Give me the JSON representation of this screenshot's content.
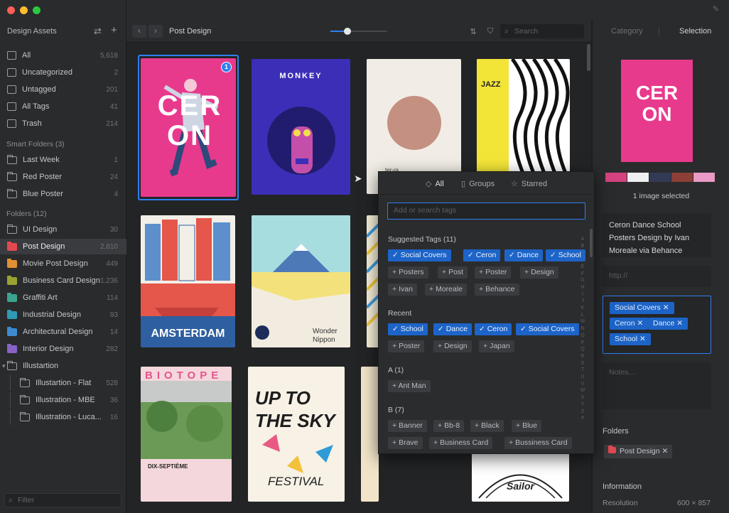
{
  "sidebar": {
    "title": "Design Assets",
    "library": [
      {
        "label": "All",
        "count": "5,618",
        "icon": "grid-icon"
      },
      {
        "label": "Uncategorized",
        "count": "2",
        "icon": "uncategorized-icon"
      },
      {
        "label": "Untagged",
        "count": "201",
        "icon": "untagged-icon"
      },
      {
        "label": "All Tags",
        "count": "41",
        "icon": "tag-icon"
      },
      {
        "label": "Trash",
        "count": "214",
        "icon": "trash-icon"
      }
    ],
    "smart_title": "Smart Folders (3)",
    "smart": [
      {
        "label": "Last Week",
        "count": "1"
      },
      {
        "label": "Red Poster",
        "count": "24"
      },
      {
        "label": "Blue Poster",
        "count": "4"
      }
    ],
    "folders_title": "Folders (12)",
    "folders": [
      {
        "label": "UI Design",
        "count": "30",
        "color": "#3a3b3e"
      },
      {
        "label": "Post Design",
        "count": "2,810",
        "color": "#e2494f"
      },
      {
        "label": "Movie Post Design",
        "count": "449",
        "color": "#e28f35"
      },
      {
        "label": "Business Card Design",
        "count": "1,236",
        "color": "#9aa233"
      },
      {
        "label": "Graffiti Art",
        "count": "114",
        "color": "#3aa58c"
      },
      {
        "label": "Industrial Design",
        "count": "93",
        "color": "#2f9ab3"
      },
      {
        "label": "Architectural Design",
        "count": "14",
        "color": "#3c8ad0"
      },
      {
        "label": "Interior Design",
        "count": "282",
        "color": "#8763c4"
      },
      {
        "label": "Illustartion",
        "count": "",
        "color": ""
      },
      {
        "label": "Illustartion - Flat",
        "count": "528",
        "color": ""
      },
      {
        "label": "Illustration - MBE",
        "count": "36",
        "color": ""
      },
      {
        "label": "Illustration - Luca...",
        "count": "16",
        "color": ""
      }
    ],
    "filter_placeholder": "Filter"
  },
  "toolbar": {
    "title": "Post Design",
    "zoom": 0.3,
    "search_placeholder": "Search"
  },
  "grid": {
    "badge": "1",
    "cards": [
      {
        "text": "CER ON",
        "sub": "",
        "bg": "#e83a8c",
        "fg": "#ffffff"
      },
      {
        "text": "MONKEY",
        "sub": "",
        "bg": "#3b2fb8",
        "fg": "#ffffff"
      },
      {
        "text": "ter-ra",
        "sub": "",
        "bg": "#f1ede6",
        "fg": "#444"
      },
      {
        "text": "JAZZ",
        "sub": "",
        "bg": "#ffffff",
        "fg": "#222"
      },
      {
        "text": "AMSTERDAM",
        "sub": "",
        "bg": "#2e5fa0",
        "fg": "#ffffff"
      },
      {
        "text": "Wonder Nippon",
        "sub": "",
        "bg": "#f2ece0",
        "fg": "#333"
      },
      {
        "text": "",
        "sub": "",
        "bg": "#f6efd9",
        "fg": "#333"
      },
      {
        "text": "",
        "sub": "",
        "bg": "#ffffff",
        "fg": "#333"
      },
      {
        "text": "BIOTOPE",
        "sub": "DIX-SEPTIÈME",
        "bg": "#f4d7dc",
        "fg": "#e4558e"
      },
      {
        "text": "UP TO THE SKY",
        "sub": "FESTIVAL",
        "bg": "#f7f1e6",
        "fg": "#222"
      },
      {
        "text": "",
        "sub": "",
        "bg": "#f1e4c8",
        "fg": "#222"
      },
      {
        "text": "Sailor",
        "sub": "",
        "bg": "#ffffff",
        "fg": "#222"
      }
    ]
  },
  "inspector": {
    "tab_category": "Category",
    "tab_selection": "Selection",
    "palette": [
      "#d4437f",
      "#eef0f2",
      "#333a55",
      "#8c3f36",
      "#e89ac4"
    ],
    "selected_text": "1 image selected",
    "name_lines": [
      "Ceron Dance School",
      "Posters Design by Ivan",
      "Moreale via Behance"
    ],
    "url_placeholder": "http://",
    "tags": [
      "Social Covers",
      "Ceron",
      "Dance",
      "School"
    ],
    "notes_placeholder": "Notes...",
    "folders_label": "Folders",
    "folder_chip": "Post Design",
    "information_label": "Information",
    "resolution_label": "Resolution",
    "resolution_value": "600 × 857"
  },
  "popup": {
    "tabs": [
      "All",
      "Groups",
      "Starred"
    ],
    "search_placeholder": "Add or search tags",
    "suggested_title": "Suggested Tags (11)",
    "suggested": [
      {
        "label": "Social Covers",
        "on": true
      },
      {
        "label": "Ceron",
        "on": true
      },
      {
        "label": "Dance",
        "on": true
      },
      {
        "label": "School",
        "on": true
      },
      {
        "label": "Posters",
        "on": false
      },
      {
        "label": "Post",
        "on": false
      },
      {
        "label": "Poster",
        "on": false
      },
      {
        "label": "Design",
        "on": false
      },
      {
        "label": "Ivan",
        "on": false
      },
      {
        "label": "Moreale",
        "on": false
      },
      {
        "label": "Behance",
        "on": false
      }
    ],
    "recent_title": "Recent",
    "recent": [
      {
        "label": "School",
        "on": true
      },
      {
        "label": "Dance",
        "on": true
      },
      {
        "label": "Ceron",
        "on": true
      },
      {
        "label": "Social Covers",
        "on": true
      },
      {
        "label": "Poster",
        "on": false
      },
      {
        "label": "Design",
        "on": false
      },
      {
        "label": "Japan",
        "on": false
      }
    ],
    "a_title": "A (1)",
    "a": [
      {
        "label": "Ant Man",
        "on": false
      }
    ],
    "b_title": "B (7)",
    "b": [
      {
        "label": "Banner",
        "on": false
      },
      {
        "label": "Bb-8",
        "on": false
      },
      {
        "label": "Black",
        "on": false
      },
      {
        "label": "Blue",
        "on": false
      },
      {
        "label": "Brave",
        "on": false
      },
      {
        "label": "Business Card",
        "on": false
      },
      {
        "label": "Bussiness Card",
        "on": false
      }
    ],
    "alphabet": [
      "A",
      "B",
      "C",
      "D",
      "E",
      "F",
      "G",
      "H",
      "I",
      "J",
      "K",
      "L",
      "M",
      "N",
      "O",
      "P",
      "Q",
      "R",
      "S",
      "T",
      "U",
      "V",
      "W",
      "X",
      "Y",
      "Z",
      "#"
    ]
  }
}
